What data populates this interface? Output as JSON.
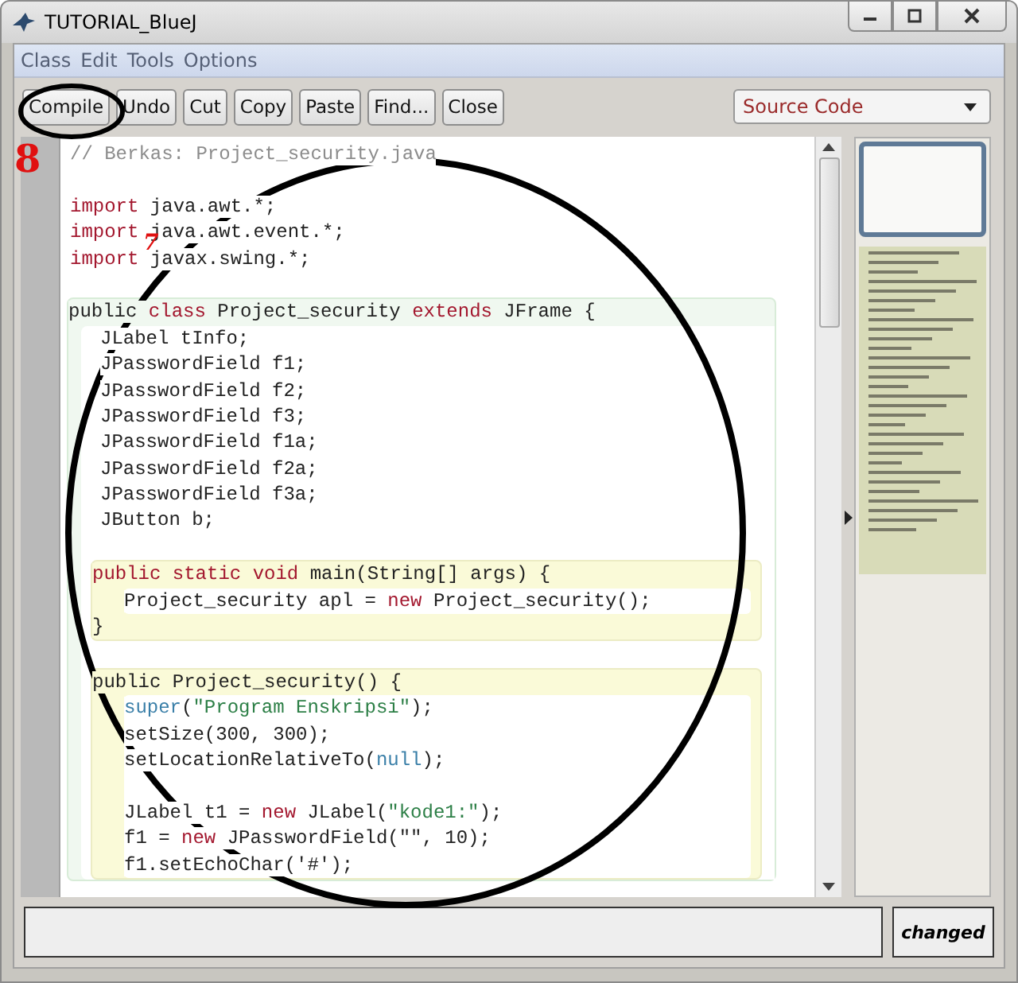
{
  "window": {
    "title": "TUTORIAL_BlueJ"
  },
  "menu": [
    "Class",
    "Edit",
    "Tools",
    "Options"
  ],
  "toolbar": {
    "buttons": [
      "Compile",
      "Undo",
      "Cut",
      "Copy",
      "Paste",
      "Find...",
      "Close"
    ],
    "view_select": {
      "value": "Source Code"
    }
  },
  "code": [
    {
      "kind": "line",
      "tokens": [
        {
          "kind": "comment",
          "text": "// Berkas: Project_security.java"
        }
      ]
    },
    {
      "kind": "blank"
    },
    {
      "kind": "line",
      "tokens": [
        {
          "kind": "keyword",
          "text": "import"
        },
        {
          "kind": "plain",
          "text": " java.awt.*;"
        }
      ]
    },
    {
      "kind": "line",
      "tokens": [
        {
          "kind": "keyword",
          "text": "import"
        },
        {
          "kind": "plain",
          "text": " java.awt.event.*;"
        }
      ]
    },
    {
      "kind": "line",
      "tokens": [
        {
          "kind": "keyword",
          "text": "import"
        },
        {
          "kind": "plain",
          "text": " javax.swing.*;"
        }
      ]
    },
    {
      "kind": "blank"
    },
    {
      "kind": "class-block",
      "head": [
        {
          "kind": "plain",
          "text": "public "
        },
        {
          "kind": "keyword",
          "text": "class"
        },
        {
          "kind": "plain",
          "text": " Project_security "
        },
        {
          "kind": "keyword",
          "text": "extends"
        },
        {
          "kind": "plain",
          "text": " JFrame {"
        }
      ],
      "children": [
        {
          "kind": "line",
          "tokens": [
            {
              "kind": "plain",
              "text": "JLabel tInfo;"
            }
          ]
        },
        {
          "kind": "line",
          "tokens": [
            {
              "kind": "plain",
              "text": "JPasswordField f1;"
            }
          ]
        },
        {
          "kind": "line",
          "tokens": [
            {
              "kind": "plain",
              "text": "JPasswordField f2;"
            }
          ]
        },
        {
          "kind": "line",
          "tokens": [
            {
              "kind": "plain",
              "text": "JPasswordField f3;"
            }
          ]
        },
        {
          "kind": "line",
          "tokens": [
            {
              "kind": "plain",
              "text": "JPasswordField f1a;"
            }
          ]
        },
        {
          "kind": "line",
          "tokens": [
            {
              "kind": "plain",
              "text": "JPasswordField f2a;"
            }
          ]
        },
        {
          "kind": "line",
          "tokens": [
            {
              "kind": "plain",
              "text": "JPasswordField f3a;"
            }
          ]
        },
        {
          "kind": "line",
          "tokens": [
            {
              "kind": "plain",
              "text": "JButton b;"
            }
          ]
        },
        {
          "kind": "blank"
        },
        {
          "kind": "method-block",
          "head": [
            {
              "kind": "keyword",
              "text": "public static void"
            },
            {
              "kind": "plain",
              "text": " main(String[] args) {"
            }
          ],
          "children": [
            {
              "kind": "line",
              "tokens": [
                {
                  "kind": "plain",
                  "text": "Project_security apl = "
                },
                {
                  "kind": "keyword",
                  "text": "new"
                },
                {
                  "kind": "plain",
                  "text": " Project_security();"
                }
              ]
            }
          ],
          "foot": "}"
        },
        {
          "kind": "blank"
        },
        {
          "kind": "method-block",
          "head": [
            {
              "kind": "plain",
              "text": "public Project_security() {"
            }
          ],
          "children": [
            {
              "kind": "line",
              "tokens": [
                {
                  "kind": "literal",
                  "text": "super"
                },
                {
                  "kind": "plain",
                  "text": "("
                },
                {
                  "kind": "string",
                  "text": "\"Program Enskripsi\""
                },
                {
                  "kind": "plain",
                  "text": ");"
                }
              ]
            },
            {
              "kind": "line",
              "tokens": [
                {
                  "kind": "plain",
                  "text": "setSize(300, 300);"
                }
              ]
            },
            {
              "kind": "line",
              "tokens": [
                {
                  "kind": "plain",
                  "text": "setLocationRelativeTo("
                },
                {
                  "kind": "literal",
                  "text": "null"
                },
                {
                  "kind": "plain",
                  "text": ");"
                }
              ]
            },
            {
              "kind": "blank"
            },
            {
              "kind": "line",
              "tokens": [
                {
                  "kind": "plain",
                  "text": "JLabel t1 = "
                },
                {
                  "kind": "keyword",
                  "text": "new"
                },
                {
                  "kind": "plain",
                  "text": " JLabel("
                },
                {
                  "kind": "string",
                  "text": "\"kode1:\""
                },
                {
                  "kind": "plain",
                  "text": ");"
                }
              ]
            },
            {
              "kind": "line",
              "tokens": [
                {
                  "kind": "plain",
                  "text": "f1 = "
                },
                {
                  "kind": "keyword",
                  "text": "new"
                },
                {
                  "kind": "plain",
                  "text": " JPasswordField(\"\", 10);"
                }
              ]
            },
            {
              "kind": "line",
              "tokens": [
                {
                  "kind": "plain",
                  "text": "f1.setEchoChar('#');"
                }
              ]
            }
          ]
        }
      ]
    }
  ],
  "status_bar": {
    "state": "changed"
  },
  "annotations": [
    {
      "kind": "number",
      "text": "8"
    },
    {
      "kind": "number",
      "text": "7"
    }
  ]
}
